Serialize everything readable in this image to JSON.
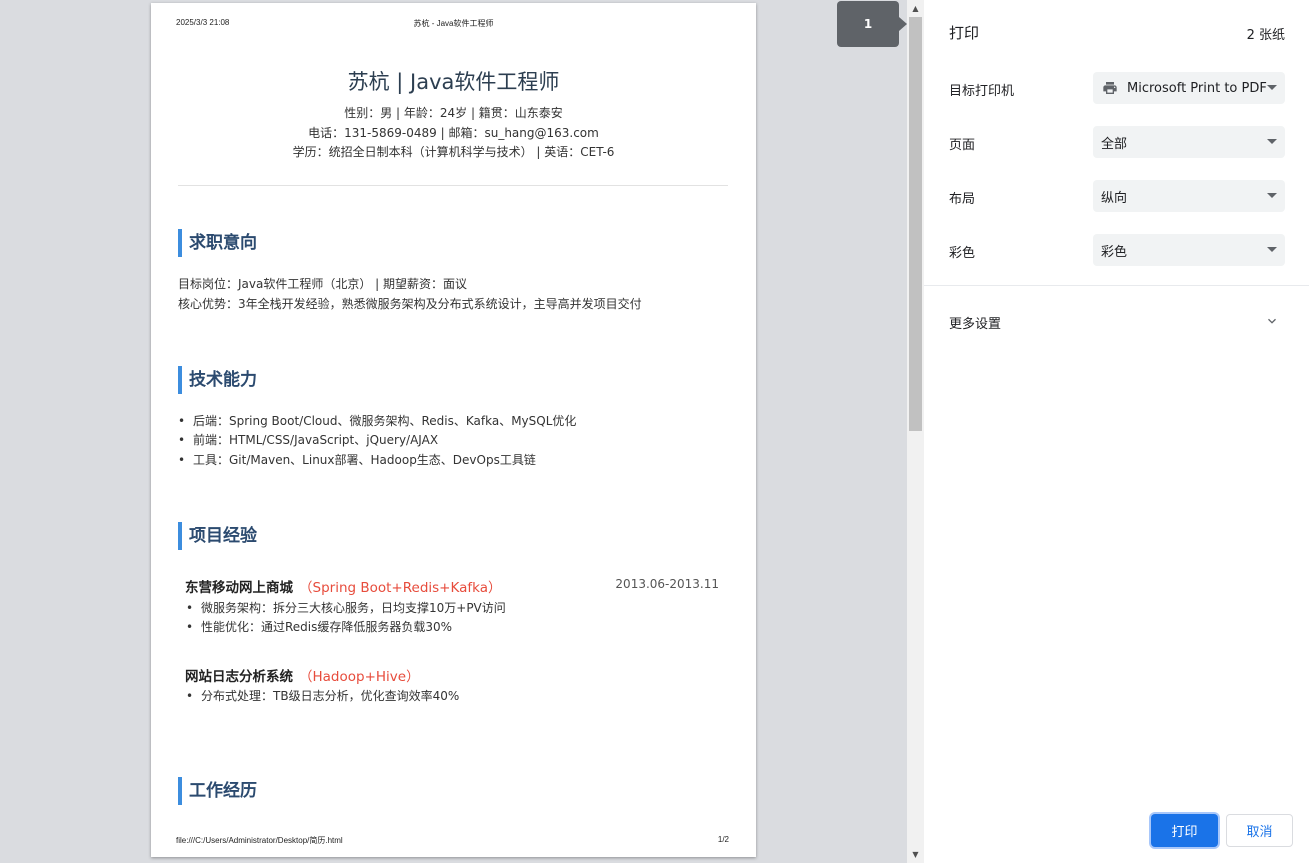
{
  "preview": {
    "page_header": {
      "date": "2025/3/3 21:08",
      "title": "苏杭 - Java软件工程师"
    },
    "page_footer": {
      "path": "file:///C:/Users/Administrator/Desktop/简历.html",
      "page_number": "1/2"
    },
    "resume": {
      "name": "苏杭 | Java软件工程师",
      "info_lines": [
        "性别：男 | 年龄：24岁 | 籍贯：山东泰安",
        "电话：131-5869-0489 | 邮箱：su_hang@163.com",
        "学历：统招全日制本科（计算机科学与技术） | 英语：CET-6"
      ],
      "sections": {
        "objective": {
          "title": "求职意向",
          "lines": [
            "目标岗位：Java软件工程师（北京） | 期望薪资：面议",
            "核心优势：3年全栈开发经验，熟悉微服务架构及分布式系统设计，主导高并发项目交付"
          ]
        },
        "skills": {
          "title": "技术能力",
          "items": [
            "后端：Spring Boot/Cloud、微服务架构、Redis、Kafka、MySQL优化",
            "前端：HTML/CSS/JavaScript、jQuery/AJAX",
            "工具：Git/Maven、Linux部署、Hadoop生态、DevOps工具链"
          ]
        },
        "projects": {
          "title": "项目经验",
          "items": [
            {
              "name": "东营移动网上商城",
              "tech": "（Spring Boot+Redis+Kafka）",
              "date": "2013.06-2013.11",
              "points": [
                "微服务架构：拆分三大核心服务，日均支撑10万+PV访问",
                "性能优化：通过Redis缓存降低服务器负载30%"
              ]
            },
            {
              "name": "网站日志分析系统",
              "tech": "（Hadoop+Hive）",
              "date": "",
              "points": [
                "分布式处理：TB级日志分析，优化查询效率40%"
              ]
            }
          ]
        },
        "work": {
          "title": "工作经历"
        }
      }
    },
    "page_badge": "1"
  },
  "settings": {
    "title": "打印",
    "sheet_count": "2 张纸",
    "rows": {
      "printer": {
        "label": "目标打印机",
        "value": "Microsoft Print to PDF"
      },
      "pages": {
        "label": "页面",
        "value": "全部"
      },
      "layout": {
        "label": "布局",
        "value": "纵向"
      },
      "color": {
        "label": "彩色",
        "value": "彩色"
      }
    },
    "more_settings": "更多设置",
    "print_button": "打印",
    "cancel_button": "取消"
  },
  "colors": {
    "accent": "#1a73e8",
    "section_bar": "#3c8dde",
    "section_title": "#2b4a6f",
    "project_tech": "#e74c3c",
    "badge_bg": "#5f6368"
  },
  "icons": [
    "printer-icon",
    "dropdown-caret-icon",
    "chevron-down-icon",
    "scroll-up-arrow-icon",
    "scroll-down-arrow-icon"
  ]
}
